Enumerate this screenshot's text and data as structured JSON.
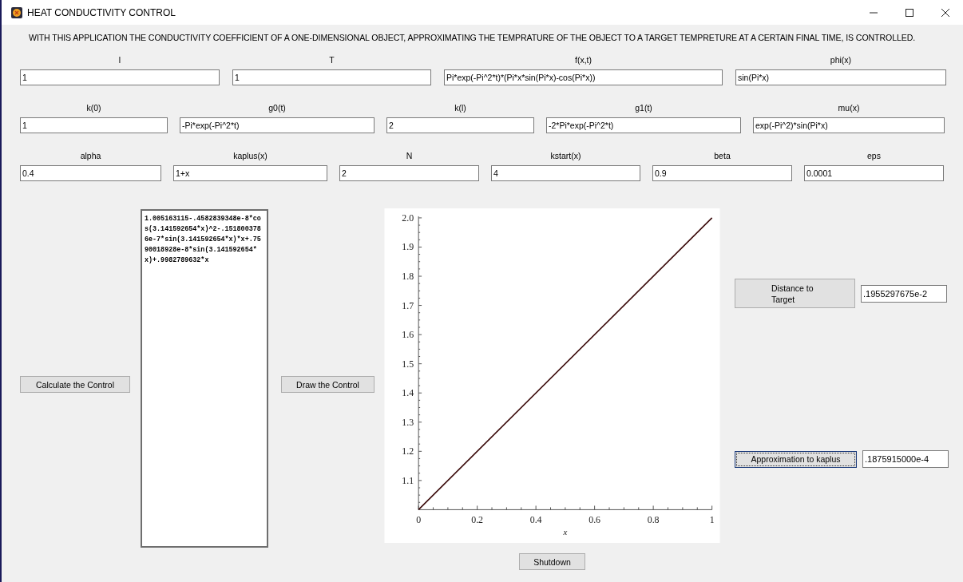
{
  "window": {
    "title": "HEAT CONDUCTIVITY CONTROL"
  },
  "description": "WITH THIS APPLICATION THE CONDUCTIVITY COEFFICIENT OF A ONE-DIMENSIONAL OBJECT, APPROXIMATING THE TEMPRATURE OF THE OBJECT TO A TARGET TEMPRETURE AT A CERTAIN FINAL TIME, IS CONTROLLED.",
  "parameter_rows": [
    [
      {
        "label": "l",
        "value": "1"
      },
      {
        "label": "T",
        "value": "1"
      },
      {
        "label": "f(x,t)",
        "value": "Pi*exp(-Pi^2*t)*(Pi*x*sin(Pi*x)-cos(Pi*x))"
      },
      {
        "label": "phi(x)",
        "value": "sin(Pi*x)"
      }
    ],
    [
      {
        "label": "k(0)",
        "value": "1"
      },
      {
        "label": "g0(t)",
        "value": "-Pi*exp(-Pi^2*t)"
      },
      {
        "label": "k(l)",
        "value": "2"
      },
      {
        "label": "g1(t)",
        "value": "-2*Pi*exp(-Pi^2*t)"
      },
      {
        "label": "mu(x)",
        "value": "exp(-Pi^2)*sin(Pi*x)"
      }
    ],
    [
      {
        "label": "alpha",
        "value": "0.4"
      },
      {
        "label": "kaplus(x)",
        "value": "1+x"
      },
      {
        "label": "N",
        "value": "2"
      },
      {
        "label": "kstart(x)",
        "value": "4"
      },
      {
        "label": "beta",
        "value": "0.9"
      },
      {
        "label": "eps",
        "value": "0.0001"
      }
    ]
  ],
  "calculate_button": "Calculate the Control",
  "control_output": "1.005163115-.4582839348e-8*cos(3.141592654*x)^2-.1518003786e-7*sin(3.141592654*x)*x+.7590018928e-8*sin(3.141592654*x)+.9982789632*x",
  "draw_button": "Draw the Control",
  "plot": {
    "chart_data": {
      "type": "line",
      "xlabel": "x",
      "x": [
        0,
        1
      ],
      "series": [
        {
          "color": "#3a0a0a",
          "values": [
            1,
            2
          ]
        }
      ],
      "xlim": [
        0,
        1
      ],
      "ylim": [
        1,
        2
      ],
      "xticks": [
        0,
        {
          "value": 0.2,
          "label": "0.2"
        },
        {
          "value": 0.4,
          "label": "0.4"
        },
        {
          "value": 0.6,
          "label": "0.6"
        },
        {
          "value": 0.8,
          "label": "0.8"
        },
        1
      ],
      "yticks": [
        {
          "value": 1.1,
          "label": "1.1"
        },
        {
          "value": 1.2,
          "label": "1.2"
        },
        {
          "value": 1.3,
          "label": "1.3"
        },
        {
          "value": 1.4,
          "label": "1.4"
        },
        {
          "value": 1.5,
          "label": "1.5"
        },
        {
          "value": 1.6,
          "label": "1.6"
        },
        {
          "value": 1.7,
          "label": "1.7"
        },
        {
          "value": 1.8,
          "label": "1.8"
        },
        {
          "value": 1.9,
          "label": "1.9"
        },
        {
          "value": 2,
          "label": "2.0"
        }
      ]
    }
  },
  "distance_button": "Distance to Target",
  "distance_value": ".1955297675e-2",
  "approximation_button": "Approximation to kaplus",
  "approximation_value": ".1875915000e-4",
  "shutdown_button": "Shutdown"
}
